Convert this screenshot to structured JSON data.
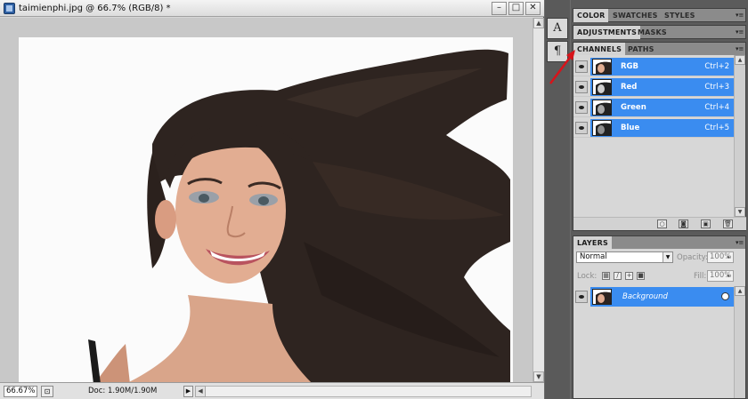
{
  "document": {
    "title": "taimienphi.jpg @ 66.7% (RGB/8) *",
    "window_buttons": [
      "–",
      "□",
      "✕"
    ],
    "zoom": "66.67%",
    "doc_size": "Doc: 1.90M/1.90M",
    "canvas_description_icon": "photo-woman-flowing-hair"
  },
  "tools": {
    "character_label": "A",
    "paragraph_label": "¶"
  },
  "panels": {
    "group1": {
      "tabs": [
        "COLOR",
        "SWATCHES",
        "STYLES"
      ],
      "active": 0
    },
    "group2": {
      "tabs": [
        "ADJUSTMENTS",
        "MASKS"
      ],
      "active": 0
    },
    "group3": {
      "tabs": [
        "CHANNELS",
        "PATHS"
      ],
      "active": 0
    },
    "channels": [
      {
        "name": "RGB",
        "shortcut": "Ctrl+2"
      },
      {
        "name": "Red",
        "shortcut": "Ctrl+3"
      },
      {
        "name": "Green",
        "shortcut": "Ctrl+4"
      },
      {
        "name": "Blue",
        "shortcut": "Ctrl+5"
      }
    ],
    "layers": {
      "tab": "LAYERS",
      "blend_mode": "Normal",
      "opacity_label": "Opacity:",
      "opacity": "100%",
      "lock_label": "Lock:",
      "fill_label": "Fill:",
      "fill": "100%",
      "items": [
        {
          "name": "Background"
        }
      ]
    }
  },
  "colors": {
    "selection": "#3a8cf0",
    "panel_bg": "#d7d7d7",
    "workspace": "#5b5b5b",
    "annotation_arrow": "#d8131a"
  }
}
